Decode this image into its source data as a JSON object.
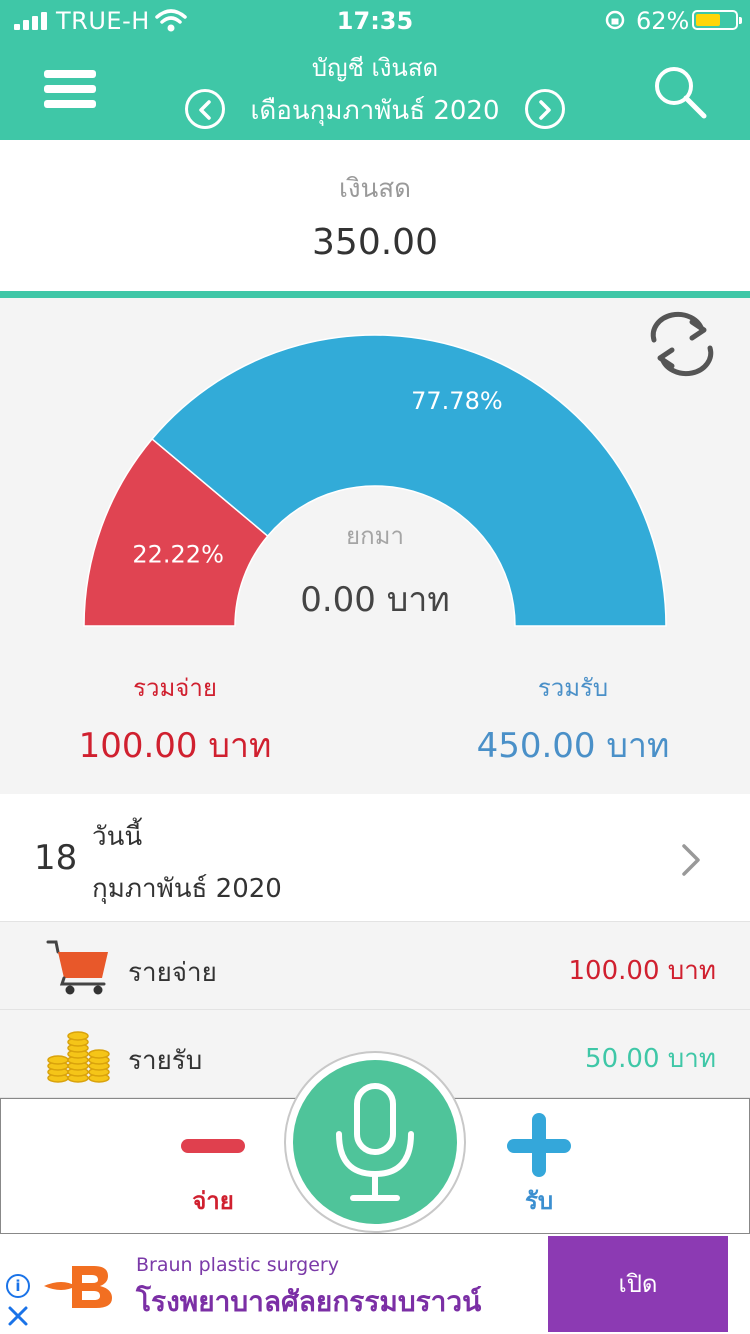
{
  "status_bar": {
    "carrier": "TRUE-H",
    "time": "17:35",
    "battery_percent": "62%",
    "battery_level": 0.62
  },
  "header": {
    "account": "บัญชี เงินสด",
    "month": "เดือนกุมภาพันธ์ 2020",
    "icons": [
      "menu-icon",
      "chevron-left-icon",
      "chevron-right-icon",
      "search-icon"
    ]
  },
  "balance": {
    "label": "เงินสด",
    "value": "350.00"
  },
  "chart": {
    "refresh_icon": "refresh-icon",
    "carry_label": "ยกมา",
    "carry_value": "0.00 บาท",
    "expense_total_label": "รวมจ่าย",
    "expense_total": "100.00 บาท",
    "income_total_label": "รวมรับ",
    "income_total": "450.00 บาท",
    "colors": {
      "expense": "#e04452",
      "income": "#32abd8"
    }
  },
  "chart_data": {
    "type": "pie",
    "categories": [
      "expense",
      "income"
    ],
    "values": [
      22.22,
      77.78
    ],
    "labels": [
      "22.22%",
      "77.78%"
    ]
  },
  "day": {
    "number": "18",
    "today": "วันนี้",
    "month": "กุมภาพันธ์ 2020"
  },
  "summary": [
    {
      "icon": "shopping-cart-icon",
      "label": "รายจ่าย",
      "amount": "100.00 บาท"
    },
    {
      "icon": "coins-icon",
      "label": "รายรับ",
      "amount": "50.00 บาท"
    }
  ],
  "actions": {
    "pay_label": "จ่าย",
    "receive_label": "รับ",
    "mic_icon": "microphone-icon"
  },
  "ad": {
    "brand": "Braun plastic surgery",
    "title": "โรงพยาบาลศัลยกรรมบราวน์",
    "cta": "เปิด"
  }
}
